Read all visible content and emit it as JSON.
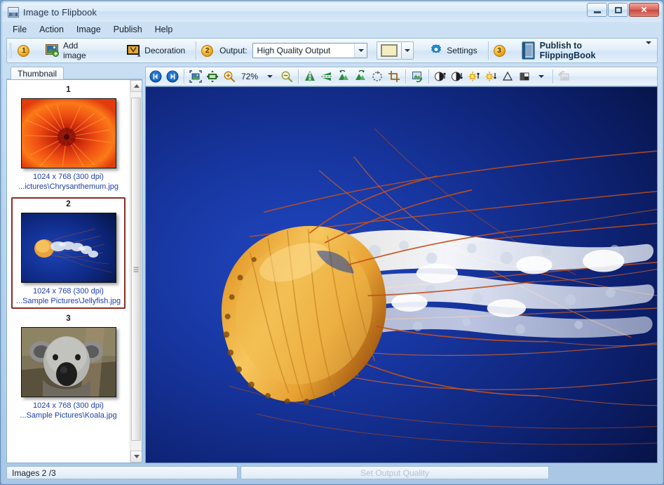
{
  "window": {
    "title": "Image to Flipbook",
    "icon": "app-icon",
    "controls": {
      "minimize": "minimize",
      "maximize": "maximize",
      "close": "✕"
    }
  },
  "menu": {
    "items": [
      {
        "label": "File",
        "accel": "F"
      },
      {
        "label": "Action",
        "accel": "A"
      },
      {
        "label": "Image",
        "accel": "I"
      },
      {
        "label": "Publish",
        "accel": "P"
      },
      {
        "label": "Help",
        "accel": "H"
      }
    ]
  },
  "toolbar": {
    "step1_badge": "1",
    "add_image_label": "Add image",
    "add_image_accel": "d",
    "decoration_label": "Decoration",
    "step2_badge": "2",
    "output_label": "Output:",
    "output_value": "High Quality Output",
    "output_options": [
      "High Quality Output"
    ],
    "settings_label": "Settings",
    "settings_accel": "t",
    "step3_badge": "3",
    "publish_label": "Publish to FlippingBook",
    "publish_accel": "P"
  },
  "left_panel": {
    "tab_label": "Thumbnail",
    "tab_accel": "T",
    "thumbnails": [
      {
        "number": "1",
        "dimensions": "1024 x 768 (300 dpi)",
        "path": "...ictures\\Chrysanthemum.jpg",
        "image": "chrysanthemum-thumbnail",
        "selected": false
      },
      {
        "number": "2",
        "dimensions": "1024 x 768 (300 dpi)",
        "path": "...Sample Pictures\\Jellyfish.jpg",
        "image": "jellyfish-thumbnail",
        "selected": true
      },
      {
        "number": "3",
        "dimensions": "1024 x 768 (300 dpi)",
        "path": "...Sample Pictures\\Koala.jpg",
        "image": "koala-thumbnail",
        "selected": false
      }
    ]
  },
  "image_toolbar": {
    "zoom_value": "72%",
    "buttons": [
      "previous-image-icon",
      "next-image-icon",
      "fit-to-window-icon",
      "actual-size-icon",
      "zoom-in-icon",
      "zoom-out-icon",
      "flip-horizontal-icon",
      "flip-vertical-icon",
      "rotate-left-icon",
      "rotate-right-icon",
      "rotate-free-icon",
      "crop-icon",
      "resize-image-icon",
      "contrast-increase-icon",
      "contrast-decrease-icon",
      "brightness-increase-icon",
      "brightness-decrease-icon",
      "sharpen-icon",
      "grayscale-icon",
      "undo-icon"
    ]
  },
  "canvas": {
    "image_name": "jellyfish-preview",
    "background_color": "#0b1a52"
  },
  "status_bar": {
    "images_count": "Images 2 /3",
    "progress_text": "Set Output Quality"
  },
  "colors": {
    "accent_blue": "#1d3faa",
    "selection_red": "#8c2b22",
    "badge_orange": "#f0a81d",
    "canvas_blue": "#0b1a52"
  }
}
